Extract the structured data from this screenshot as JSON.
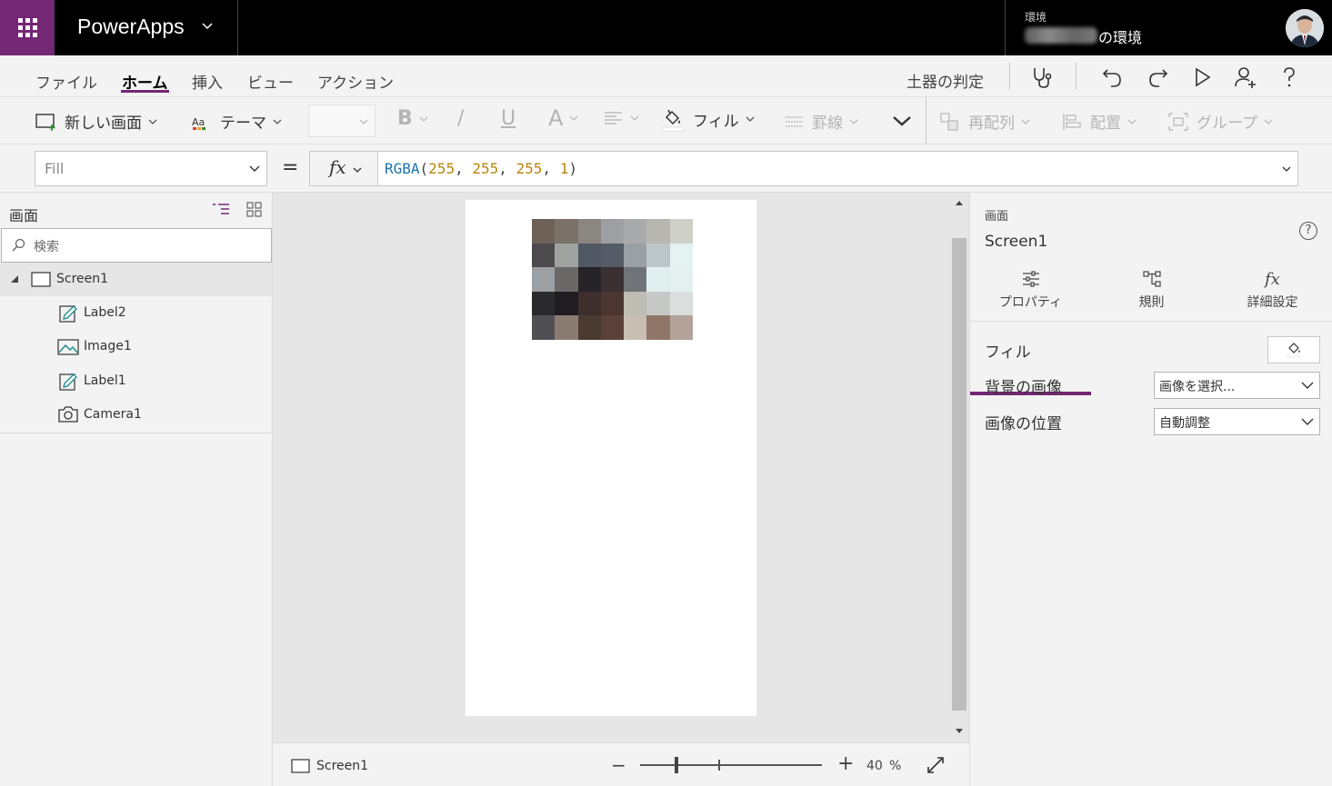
{
  "app": {
    "name": "PowerApps"
  },
  "environment": {
    "label": "環境",
    "name_suffix": "の環境"
  },
  "menu": {
    "items": [
      "ファイル",
      "ホーム",
      "挿入",
      "ビュー",
      "アクション"
    ],
    "active": "ホーム",
    "app_checker": "土器の判定"
  },
  "ribbon": {
    "new_screen": "新しい画面",
    "theme": "テーマ",
    "bold": "B",
    "italic": "/",
    "underline": "U",
    "font_color": "A",
    "fill": "フィル",
    "border": "罫線",
    "reorder": "再配列",
    "align": "配置",
    "group": "グループ"
  },
  "formula": {
    "property": "Fill",
    "equals": "=",
    "fx": "fx",
    "fn": "RGBA",
    "args": [
      "255",
      "255",
      "255",
      "1"
    ]
  },
  "left_panel": {
    "title": "画面",
    "search_placeholder": "検索",
    "tree": [
      {
        "label": "Screen1",
        "icon": "screen-icon",
        "level": 0,
        "selected": true
      },
      {
        "label": "Label2",
        "icon": "label-icon",
        "level": 1
      },
      {
        "label": "Image1",
        "icon": "image-icon",
        "level": 1
      },
      {
        "label": "Label1",
        "icon": "label-icon",
        "level": 1
      },
      {
        "label": "Camera1",
        "icon": "camera-icon",
        "level": 1
      }
    ]
  },
  "canvas": {
    "screen_label": "Screen1",
    "zoom_value": "40",
    "zoom_unit": "%",
    "zoom_minus": "−",
    "zoom_plus": "+",
    "mosaic_colors": [
      "#6e6258",
      "#7a7268",
      "#8c8680",
      "#9da0a3",
      "#a9aaac",
      "#b7b6b0",
      "#cfd0c8",
      "#4c4a4c",
      "#9fa3a0",
      "#505864",
      "#545a66",
      "#9aa0a6",
      "#bcc6c8",
      "#e4f2f2",
      "#9aa0a3",
      "#6a6866",
      "#262428",
      "#3b3032",
      "#707478",
      "#e0eeee",
      "#e4f0f0",
      "#2a2a2e",
      "#1f1c22",
      "#3e2e2c",
      "#4c3632",
      "#bfbcb4",
      "#c6c8c6",
      "#dadedc",
      "#505054",
      "#8a7c72",
      "#4a3a32",
      "#5a4038",
      "#c8beb2",
      "#907668",
      "#b2a29a"
    ]
  },
  "right_panel": {
    "kind": "画面",
    "name": "Screen1",
    "help": "?",
    "tabs": [
      "プロパティ",
      "規則",
      "詳細設定"
    ],
    "props": {
      "fill_label": "フィル",
      "bg_image_label": "背景の画像",
      "bg_image_value": "画像を選択...",
      "image_position_label": "画像の位置",
      "image_position_value": "自動調整"
    }
  },
  "colors": {
    "accent": "#742774",
    "topbar": "#000000",
    "function": "#1a73a8",
    "number": "#b8860b"
  }
}
